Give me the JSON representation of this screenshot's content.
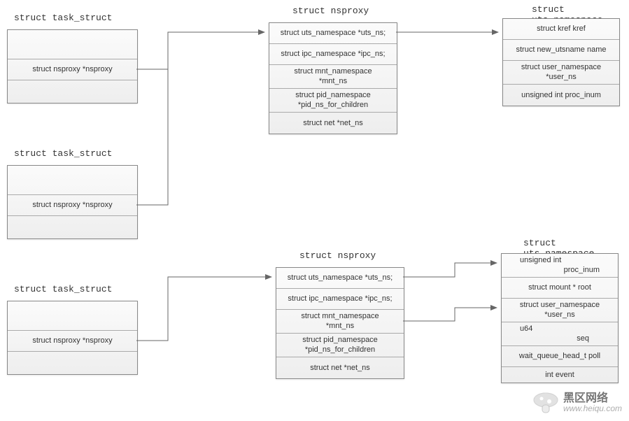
{
  "titles": {
    "task1": "struct task_struct",
    "task2": "struct task_struct",
    "task3": "struct task_struct",
    "nsproxy1": "struct nsproxy",
    "nsproxy2": "struct nsproxy",
    "uts1": "struct uts_namespace",
    "mnt_ns_title2": "struct uts_namespace"
  },
  "task": {
    "nsproxy_field": "struct nsproxy *nsproxy"
  },
  "nsproxy": {
    "uts_ns": "struct uts_namespace *uts_ns;",
    "ipc_ns": "struct ipc_namespace *ipc_ns;",
    "mnt_ns_line1": "struct mnt_namespace",
    "mnt_ns_line2": "*mnt_ns",
    "pid_ns_line1": "struct pid_namespace",
    "pid_ns_line2": "*pid_ns_for_children",
    "net_ns": "struct net    *net_ns"
  },
  "uts_ns": {
    "kref": "struct kref kref",
    "name": "struct new_utsname name",
    "user_ns_line1": "struct user_namespace",
    "user_ns_line2": "*user_ns",
    "proc_inum": "unsigned int proc_inum"
  },
  "mnt_ns": {
    "proc_inum_l1": "unsigned int",
    "proc_inum_l2": "proc_inum",
    "root": "struct mount *       root",
    "user_ns_line1": "struct user_namespace",
    "user_ns_line2": "*user_ns",
    "seq_l1": "u64",
    "seq_l2": "seq",
    "poll": "wait_queue_head_t poll",
    "event": "int event"
  },
  "watermark": {
    "cn": "黑区网络",
    "domain": "www.heiqu.com"
  }
}
